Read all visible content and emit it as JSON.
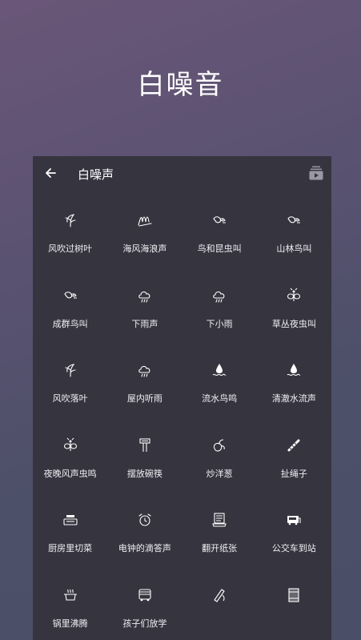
{
  "hero": {
    "title": "白噪音"
  },
  "panel": {
    "title": "白噪声",
    "back_icon": "arrow-left-icon",
    "media_icon": "playlist-icon"
  },
  "sounds": [
    {
      "label": "风吹过树叶",
      "icon": "leaf-icon"
    },
    {
      "label": "海风海浪声",
      "icon": "wave-icon"
    },
    {
      "label": "鸟和昆虫叫",
      "icon": "bird-icon"
    },
    {
      "label": "山林鸟叫",
      "icon": "bird-icon"
    },
    {
      "label": "成群鸟叫",
      "icon": "bird-icon"
    },
    {
      "label": "下雨声",
      "icon": "rain-cloud-icon"
    },
    {
      "label": "下小雨",
      "icon": "rain-cloud-icon"
    },
    {
      "label": "草丛夜虫叫",
      "icon": "insect-icon"
    },
    {
      "label": "风吹落叶",
      "icon": "leaf-icon"
    },
    {
      "label": "屋内听雨",
      "icon": "rain-cloud-icon"
    },
    {
      "label": "流水鸟鸣",
      "icon": "water-drop-icon"
    },
    {
      "label": "清澈水流声",
      "icon": "water-drop-icon"
    },
    {
      "label": "夜晚风声虫鸣",
      "icon": "insect-icon"
    },
    {
      "label": "摆放碗筷",
      "icon": "chopsticks-icon"
    },
    {
      "label": "炒洋葱",
      "icon": "onion-icon"
    },
    {
      "label": "扯绳子",
      "icon": "rope-icon"
    },
    {
      "label": "厨房里切菜",
      "icon": "cutting-board-icon"
    },
    {
      "label": "电钟的滴答声",
      "icon": "alarm-clock-icon"
    },
    {
      "label": "翻开纸张",
      "icon": "paper-icon"
    },
    {
      "label": "公交车到站",
      "icon": "bus-stop-icon"
    },
    {
      "label": "锅里沸腾",
      "icon": "pot-icon"
    },
    {
      "label": "孩子们放学",
      "icon": "school-bus-icon"
    },
    {
      "label": "",
      "icon": "pen-icon"
    },
    {
      "label": "",
      "icon": "film-icon"
    }
  ]
}
